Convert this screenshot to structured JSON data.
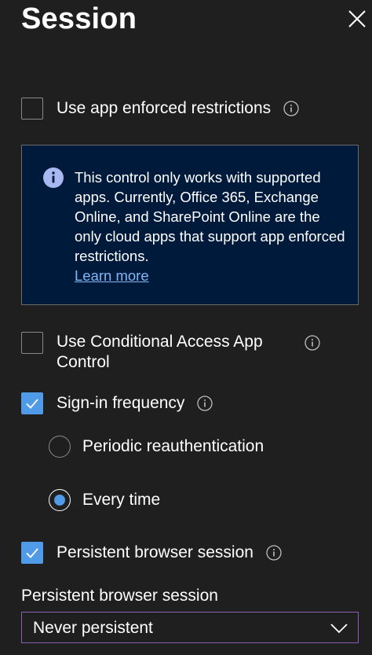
{
  "header": {
    "title": "Session"
  },
  "options": {
    "app_enforced": {
      "label": "Use app enforced restrictions",
      "checked": false
    },
    "info_box": {
      "message": "This control only works with supported apps. Currently, Office 365, Exchange Online, and SharePoint Online are the only cloud apps that support app enforced restrictions.",
      "link": "Learn more"
    },
    "conditional_access": {
      "label": "Use Conditional Access App Control",
      "checked": false
    },
    "signin_frequency": {
      "label": "Sign-in frequency",
      "checked": true,
      "choices": [
        {
          "label": "Periodic reauthentication",
          "selected": false
        },
        {
          "label": "Every time",
          "selected": true
        }
      ]
    },
    "persistent_session": {
      "label": "Persistent browser session",
      "checked": true
    }
  },
  "persistent_setting": {
    "label": "Persistent browser session",
    "selected_value": "Never persistent"
  },
  "colors": {
    "background": "#1f1f1f",
    "accent": "#4f9be8",
    "info_box_bg": "#001a3c",
    "link": "#7fb7f7",
    "dropdown_border": "#8a5fb8"
  },
  "icons": [
    "close-icon",
    "info-icon",
    "checkmark-icon",
    "chevron-down-icon"
  ]
}
